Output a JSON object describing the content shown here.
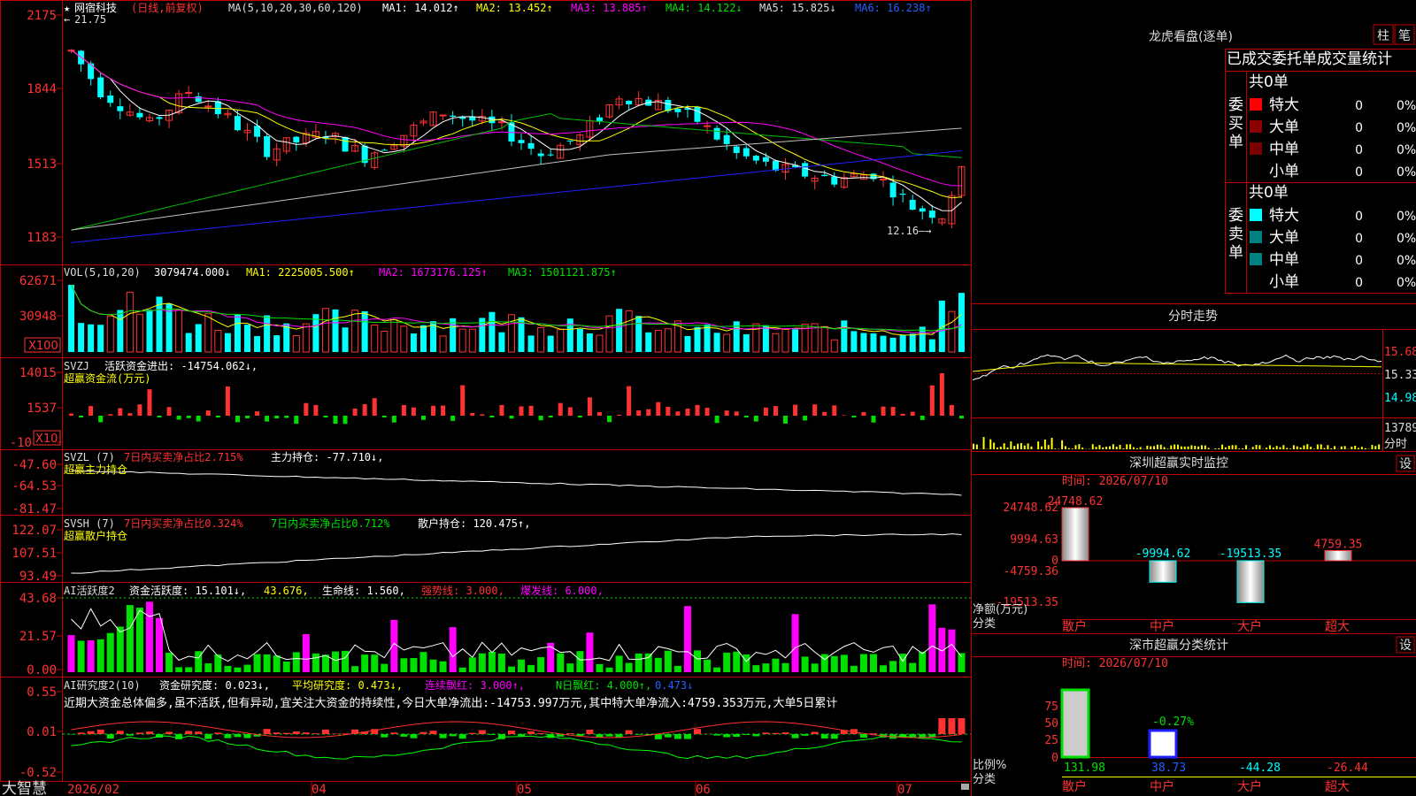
{
  "app": {
    "brand": "大智慧"
  },
  "top": {
    "star": "★",
    "code": "网宿科技",
    "mode": "(日线,前复权)",
    "ma_head": "MA(5,10,20,30,60,120)",
    "ma1": "MA1: 14.012↑",
    "ma2": "MA2: 13.452↑",
    "ma3": "MA3: 13.885↑",
    "ma4": "MA4: 14.122↓",
    "ma5": "MA5: 15.825↓",
    "ma6": "MA6: 16.238↑",
    "high_label": "21.75",
    "low_label": "12.16",
    "y_labels": [
      "2175",
      "1844",
      "1513",
      "1183"
    ]
  },
  "vol": {
    "head": "VOL(5,10,20)",
    "v1": "3079474.000↓",
    "v2": "MA1: 2225005.500↑",
    "v3": "MA2: 1673176.125↑",
    "v4": "MA3: 1501121.875↑",
    "y_labels": [
      "62671",
      "30948"
    ],
    "mult": "X100"
  },
  "svzj": {
    "head": "SVZJ",
    "v1": "活跃资金进出: -14754.062↓,",
    "title": "超赢资金流(万元)",
    "y_labels": [
      "14015",
      "1537",
      "-10"
    ],
    "mult": "X10"
  },
  "svzl": {
    "head": "SVZL (7)",
    "v1": "7日内买卖净占比2.715%",
    "v2": "主力持仓: -77.710↓,",
    "title": "超赢主力持仓",
    "y_labels": [
      "-47.60",
      "-64.53",
      "-81.47"
    ]
  },
  "svsh": {
    "head": "SVSH (7)",
    "v1": "7日内买卖净占比0.324%",
    "v2": "7日内买卖净占比0.712%",
    "v3": "散户持仓: 120.475↑,",
    "title": "超赢散户持仓",
    "y_labels": [
      "122.07",
      "107.51",
      "93.49"
    ]
  },
  "ai1": {
    "head": "AI活跃度2",
    "v1": "资金活跃度: 15.101↓,",
    "v2": "43.676,",
    "v3": "生命线: 1.560,",
    "v4": "强势线: 3.000,",
    "v5": "爆发线: 6.000,",
    "y_labels": [
      "43.68",
      "21.57",
      "0.00"
    ]
  },
  "ai2": {
    "head": "AI研究度2(10)",
    "v1": "资金研究度: 0.023↓,",
    "v2": "平均研究度: 0.473↓,",
    "v3": "连续飘红: 3.000↑,",
    "v4": "N日飘红: 4.000↑,",
    "v5": "0.473↓",
    "desc": "近期大资金总体偏多,虽不活跃,但有异动,宜关注大资金的持续性,今日大单净流出:-14753.997万元,其中特大单净流入:4759.353万元,大单5日累计",
    "y_labels": [
      "0.55",
      "0.01",
      "-0.52"
    ]
  },
  "xaxis": [
    "2026/02",
    "04",
    "05",
    "06",
    "07"
  ],
  "rp": {
    "title": "龙虎看盘(逐单)",
    "btn_col": "柱",
    "btn_pen": "笔",
    "subtitle": "已成交委托单成交量统计",
    "buy": {
      "label": "委买单",
      "total": "共0单",
      "rows": [
        {
          "name": "特大",
          "v": "0",
          "p": "0%"
        },
        {
          "name": "大单",
          "v": "0",
          "p": "0%"
        },
        {
          "name": "中单",
          "v": "0",
          "p": "0%"
        },
        {
          "name": "小单",
          "v": "0",
          "p": "0%"
        }
      ]
    },
    "sell": {
      "label": "委卖单",
      "total": "共0单",
      "rows": [
        {
          "name": "特大",
          "v": "0",
          "p": "0%"
        },
        {
          "name": "大单",
          "v": "0",
          "p": "0%"
        },
        {
          "name": "中单",
          "v": "0",
          "p": "0%"
        },
        {
          "name": "小单",
          "v": "0",
          "p": "0%"
        }
      ]
    }
  },
  "fs": {
    "title": "分时走势",
    "p1": "15.68",
    "p2": "15.33",
    "p3": "14.98",
    "v1": "13789",
    "v2": "分时"
  },
  "sz": {
    "title": "深圳超赢实时监控",
    "btn": "设",
    "time": "时间: 2026/07/10",
    "y_labels": [
      "24748.62",
      "9994.63",
      "0",
      "-4759.36",
      "-19513.35"
    ],
    "bars": [
      {
        "name": "散户",
        "val": "24748.62"
      },
      {
        "name": "中户",
        "val": "-9994.62"
      },
      {
        "name": "大户",
        "val": "-19513.35"
      },
      {
        "name": "超大",
        "val": "4759.35"
      }
    ],
    "ylabel1": "净额(万元)",
    "ylabel2": "分类"
  },
  "sc": {
    "title": "深市超赢分类统计",
    "btn": "设",
    "time": "时间: 2026/07/10",
    "y_labels": [
      "75",
      "50",
      "25",
      "0"
    ],
    "vals": [
      "131.98",
      "38.73",
      "-44.28",
      "-26.44"
    ],
    "bar_label": "-0.27%",
    "cats": [
      "散户",
      "中户",
      "大户",
      "超大"
    ],
    "ylabel1": "比例%",
    "ylabel2": "分类"
  },
  "colors": {
    "up": "#ff3232",
    "down": "#00ffff",
    "grid": "#b00000",
    "yellow": "#ffff00",
    "magenta": "#ff00ff",
    "green": "#00e000",
    "white": "#ffffff",
    "blue": "#2020ff"
  }
}
